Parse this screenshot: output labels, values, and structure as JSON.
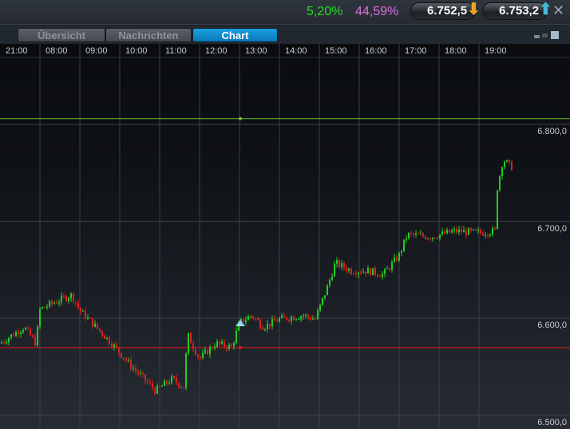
{
  "header": {
    "change_pct": "5,20%",
    "change_color": "#22dd22",
    "second_pct": "44,59%",
    "second_color": "#e070e0",
    "bid": "6.752,5",
    "bid_arrow": "down-arrow",
    "ask": "6.753,2",
    "ask_arrow": "up-arrow",
    "close_icon": "close-icon"
  },
  "tabs": [
    {
      "label": "Übersicht",
      "active": false
    },
    {
      "label": "Nachrichten",
      "active": false
    },
    {
      "label": "Chart",
      "active": true
    }
  ],
  "chart_data": {
    "type": "candlestick",
    "time_labels": [
      "21:00",
      "08:00",
      "09:00",
      "10:00",
      "11:00",
      "12:00",
      "13:00",
      "14:00",
      "15:00",
      "16:00",
      "17:00",
      "18:00",
      "19:00"
    ],
    "price_labels": [
      "6.800,0",
      "6.700,0",
      "6.600,0",
      "6.500,0"
    ],
    "price_ticks": [
      6800,
      6700,
      6600,
      6500
    ],
    "ylim": [
      6490,
      6810
    ],
    "upper_line": 6806,
    "upper_line_color": "#6fbf2a",
    "lower_line": 6569.6,
    "lower_line_color": "#e01818",
    "up_color": "#22cc22",
    "down_color": "#dd2020",
    "marker": {
      "slot": 6.02,
      "price": 6595,
      "shape": "triangle-up",
      "color": "#8fd8e8"
    },
    "path_slot_price": [
      [
        0,
        6574
      ],
      [
        0.6,
        6591
      ],
      [
        0.9,
        6574
      ],
      [
        1.0,
        6609
      ],
      [
        1.4,
        6617
      ],
      [
        1.8,
        6624
      ],
      [
        2.0,
        6608
      ],
      [
        2.4,
        6591
      ],
      [
        2.8,
        6574
      ],
      [
        3.3,
        6550
      ],
      [
        3.9,
        6525
      ],
      [
        4.3,
        6537
      ],
      [
        4.6,
        6529
      ],
      [
        4.7,
        6583
      ],
      [
        5.0,
        6558
      ],
      [
        5.4,
        6574
      ],
      [
        5.8,
        6570
      ],
      [
        6.0,
        6595
      ],
      [
        6.3,
        6603
      ],
      [
        6.6,
        6591
      ],
      [
        7.0,
        6599
      ],
      [
        7.6,
        6603
      ],
      [
        7.9,
        6599
      ],
      [
        8.2,
        6632
      ],
      [
        8.4,
        6657
      ],
      [
        8.8,
        6649
      ],
      [
        9.2,
        6649
      ],
      [
        9.6,
        6645
      ],
      [
        10.0,
        6665
      ],
      [
        10.2,
        6686
      ],
      [
        10.8,
        6684
      ],
      [
        11.4,
        6690
      ],
      [
        12.0,
        6688
      ],
      [
        12.4,
        6690
      ],
      [
        12.44,
        6731
      ],
      [
        12.6,
        6764
      ],
      [
        12.8,
        6756
      ]
    ]
  }
}
